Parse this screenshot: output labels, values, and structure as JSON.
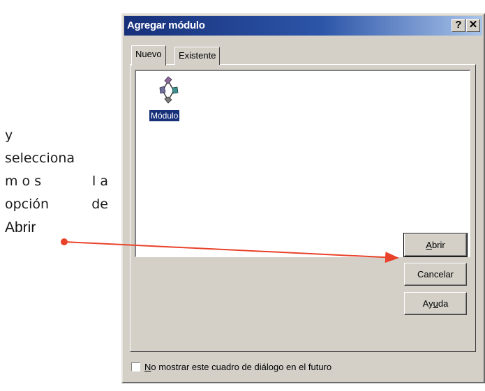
{
  "annotation": {
    "line1": "y",
    "line2": "selecciona",
    "line3_a": "m o s",
    "line3_b": "l a",
    "line4_a": "opción",
    "line4_b": "de",
    "line5": "Abrir"
  },
  "dialog": {
    "title": "Agregar módulo",
    "help_button": "?",
    "close_button": "✕",
    "tabs": [
      {
        "label": "Nuevo",
        "active": true
      },
      {
        "label": "Existente",
        "active": false
      }
    ],
    "list": {
      "items": [
        {
          "label": "Módulo",
          "icon": "vba-module-icon",
          "selected": true
        }
      ]
    },
    "buttons": {
      "open_pre": "",
      "open_mnemonic": "A",
      "open_post": "brir",
      "cancel": "Cancelar",
      "help_pre": "Ay",
      "help_mnemonic": "u",
      "help_post": "da"
    },
    "checkbox": {
      "mnemonic": "N",
      "label_rest": "o mostrar este cuadro de diálogo en el futuro",
      "checked": false
    }
  },
  "colors": {
    "titlebar_start": "#17307a",
    "titlebar_end": "#a9c4ea",
    "dialog_face": "#d4d0c8",
    "arrow": "#e8422a"
  }
}
